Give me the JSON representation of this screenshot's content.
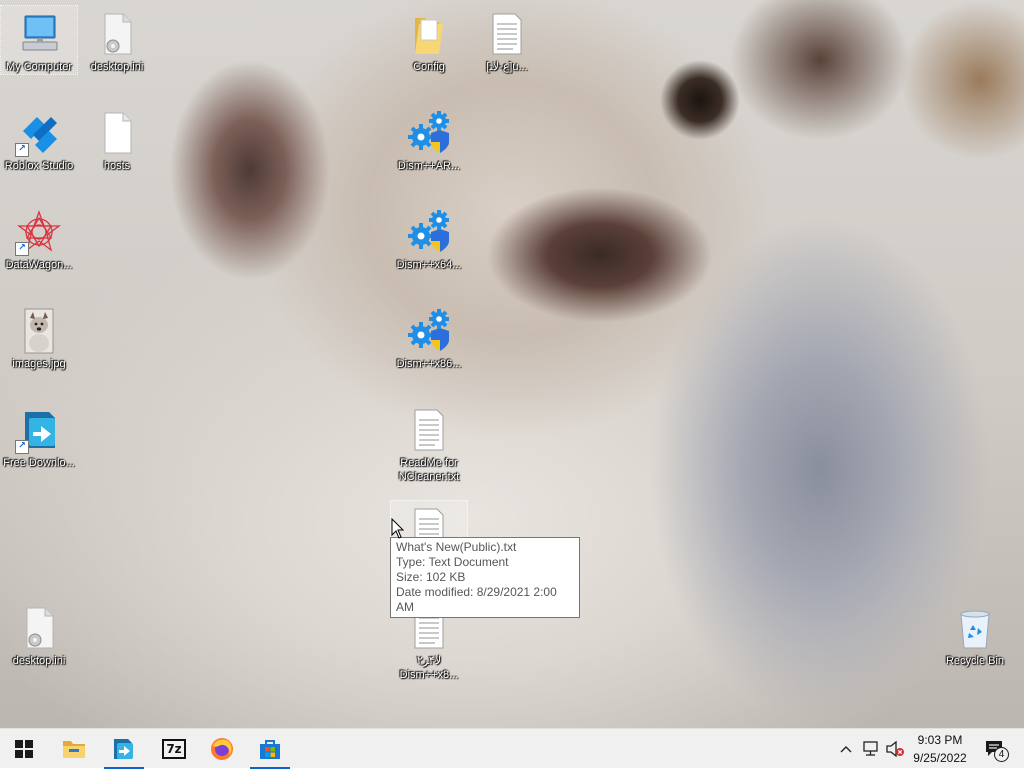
{
  "desktop_icons": [
    {
      "id": "my-computer",
      "label": "My Computer"
    },
    {
      "id": "desktop-ini-1",
      "label": "desktop.ini"
    },
    {
      "id": "roblox-studio",
      "label": "Roblox Studio"
    },
    {
      "id": "hosts",
      "label": "hosts"
    },
    {
      "id": "datawagon",
      "label": "DataWagon..."
    },
    {
      "id": "images-jpg",
      "label": "images.jpg"
    },
    {
      "id": "free-download",
      "label": "Free Downlo..."
    },
    {
      "id": "desktop-ini-2",
      "label": "desktop.ini"
    },
    {
      "id": "config",
      "label": "Config"
    },
    {
      "id": "text-file-top",
      "label": "[‌ﻉ-ﻻﺘ]u..."
    },
    {
      "id": "dism-arm",
      "label": "Dism++AR..."
    },
    {
      "id": "dism-x64",
      "label": "Dism++x64..."
    },
    {
      "id": "dism-x86",
      "label": "Dism++x86..."
    },
    {
      "id": "readme-ncleaner",
      "label": "ReadMe for NCleaner.txt"
    },
    {
      "id": "whats-new",
      "label": ""
    },
    {
      "id": "dism-x8-txt",
      "label": "۲ﻻ۴ﺮ Dism++x8..."
    },
    {
      "id": "recycle-bin",
      "label": "Recycle Bin"
    }
  ],
  "tooltip": {
    "name": "What's New(Public).txt",
    "type": "Type: Text Document",
    "size": "Size: 102 KB",
    "modified": "Date modified: 8/29/2021 2:00 AM"
  },
  "taskbar": {
    "apps": [
      {
        "name": "start",
        "icon": "windows-logo-icon"
      },
      {
        "name": "file-explorer",
        "icon": "folder-icon"
      },
      {
        "name": "free-download-manager",
        "icon": "download-manager-icon"
      },
      {
        "name": "7-zip",
        "icon": "7zip-icon",
        "text": "7z"
      },
      {
        "name": "firefox",
        "icon": "firefox-icon"
      },
      {
        "name": "microsoft-store",
        "icon": "store-icon"
      }
    ],
    "clock": {
      "time": "9:03 PM",
      "date": "9/25/2022"
    },
    "notification_count": "4"
  },
  "colors": {
    "accent": "#0a64c8",
    "gear": "#1f8ee6",
    "shield_yellow": "#f5c518"
  }
}
